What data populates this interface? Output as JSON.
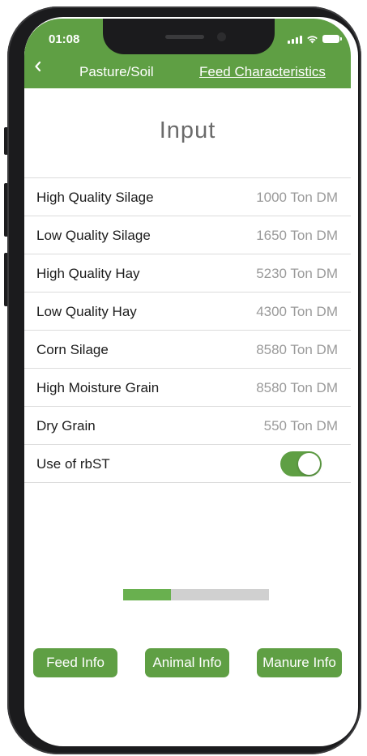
{
  "status": {
    "time": "01:08",
    "icons": [
      "signal-icon",
      "wifi-icon",
      "battery-icon"
    ]
  },
  "nav": {
    "back_icon": "chevron-left-icon",
    "left_label": "Pasture/Soil",
    "right_label": "Feed Characteristics"
  },
  "page": {
    "title": "Input"
  },
  "rows": [
    {
      "label": "High Quality Silage",
      "value": "1000 Ton DM"
    },
    {
      "label": "Low Quality Silage",
      "value": "1650 Ton DM"
    },
    {
      "label": "High Quality Hay",
      "value": "5230 Ton DM"
    },
    {
      "label": "Low Quality Hay",
      "value": "4300 Ton DM"
    },
    {
      "label": "Corn Silage",
      "value": "8580 Ton DM"
    },
    {
      "label": "High Moisture Grain",
      "value": "8580 Ton DM"
    },
    {
      "label": "Dry Grain",
      "value": "550 Ton DM"
    }
  ],
  "rbst": {
    "label": "Use of rbST",
    "enabled": true
  },
  "progress": {
    "fraction": 0.33
  },
  "buttons": {
    "feed": "Feed Info",
    "animal": "Animal Info",
    "manure": "Manure Info"
  },
  "colors": {
    "accent": "#5f9f44",
    "progress_fill": "#69b04f",
    "progress_track": "#d0d0d0",
    "value_text": "#9a9a9a"
  }
}
